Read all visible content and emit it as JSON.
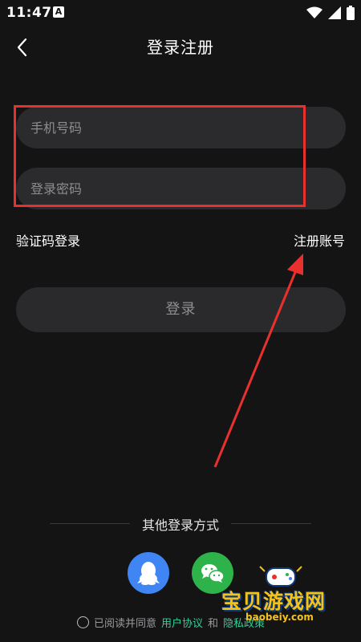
{
  "status": {
    "time": "11:47",
    "notif_glyph": "A"
  },
  "header": {
    "title": "登录注册"
  },
  "form": {
    "phone_placeholder": "手机号码",
    "phone_value": "",
    "password_placeholder": "登录密码",
    "password_value": ""
  },
  "links": {
    "sms_login": "验证码登录",
    "register": "注册账号"
  },
  "login_button": "登录",
  "other_login": {
    "heading": "其他登录方式",
    "methods": [
      {
        "name": "QQ",
        "icon": "qq-penguin-icon",
        "color": "#3f85f3"
      },
      {
        "name": "WeChat",
        "icon": "wechat-icon",
        "color": "#2eb34a"
      }
    ]
  },
  "agreement": {
    "prefix": "已阅读并同意",
    "user_agreement": "用户协议",
    "and": "和",
    "privacy": "隐私政策"
  },
  "watermark": {
    "text": "宝贝游戏网",
    "domain": "baobeiy.com"
  },
  "colors": {
    "background": "#141414",
    "field": "#2b2b2d",
    "annotation_red": "#e8312f",
    "link_green": "#2fd29c"
  }
}
